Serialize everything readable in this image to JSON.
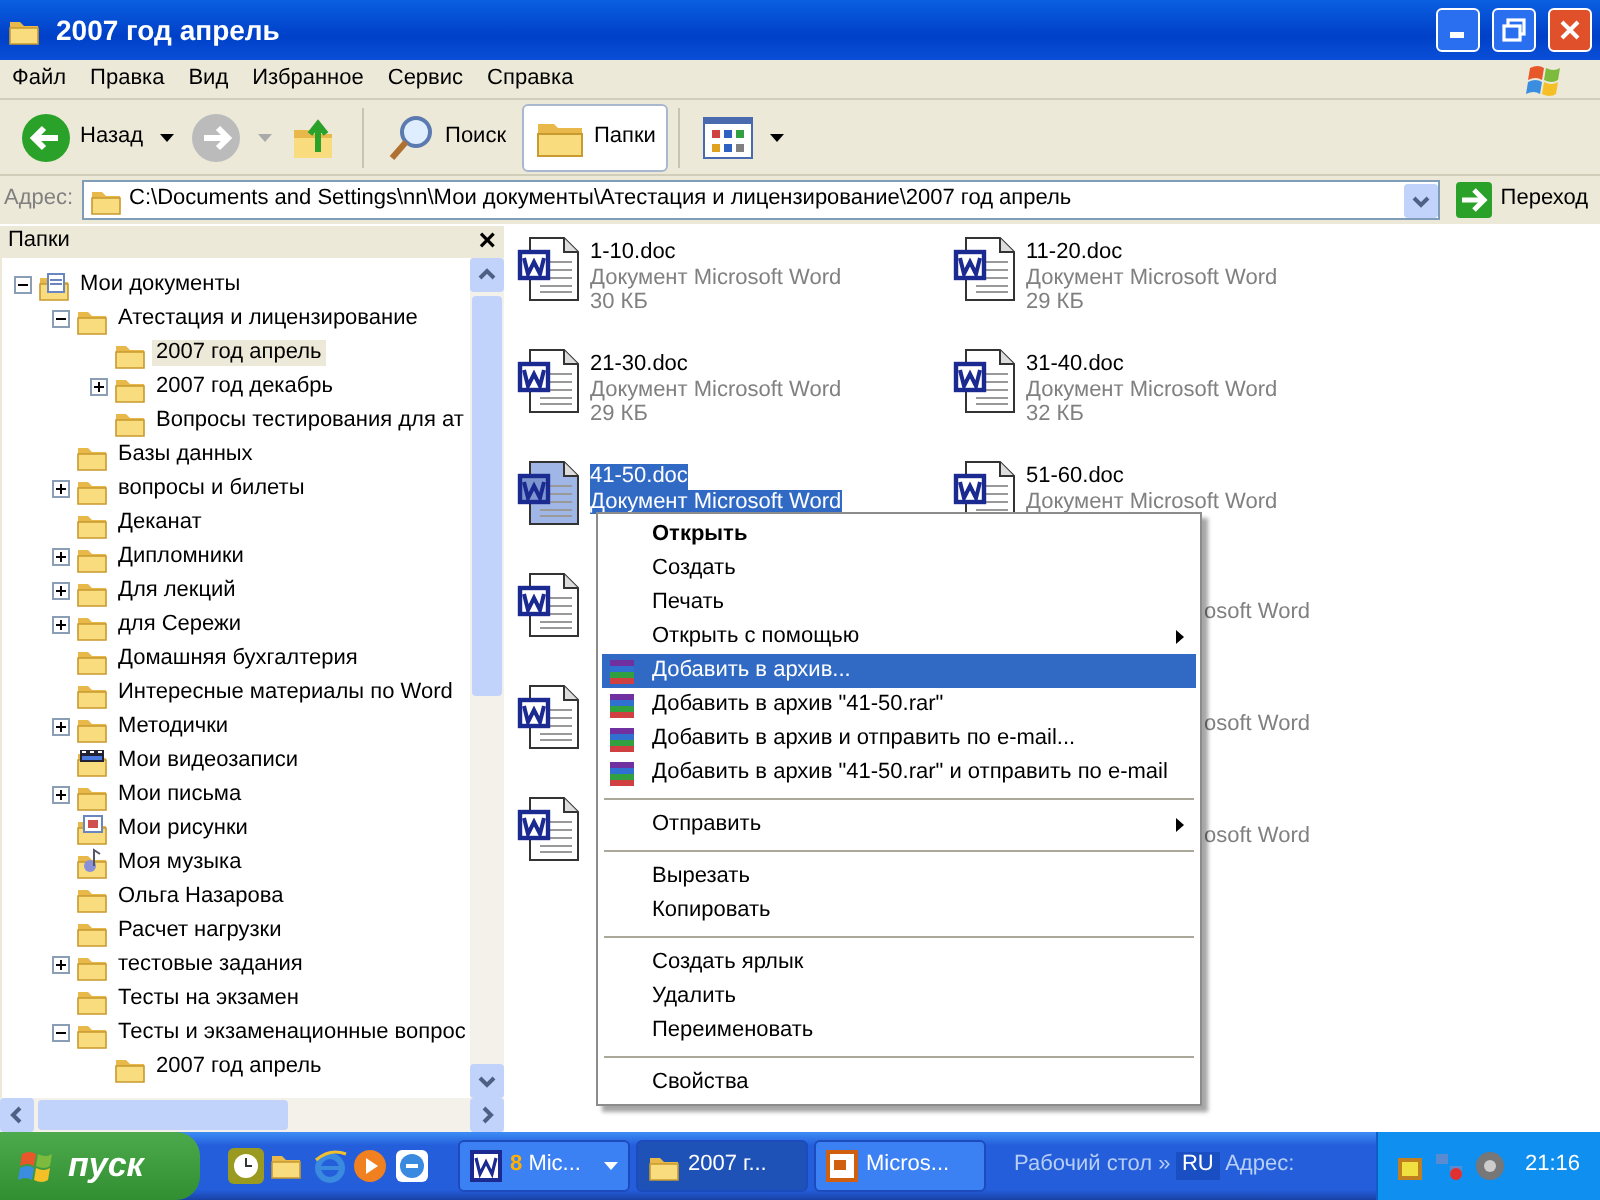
{
  "window": {
    "title": "2007 год апрель"
  },
  "menu": [
    "Файл",
    "Правка",
    "Вид",
    "Избранное",
    "Сервис",
    "Справка"
  ],
  "toolbar": [
    {
      "kind": "back",
      "label": "Назад",
      "disabled": false,
      "selected": false,
      "caret": true
    },
    {
      "kind": "forward",
      "disabled": true,
      "selected": false,
      "caret": true
    },
    {
      "kind": "up",
      "disabled": false,
      "selected": false,
      "caret": false
    },
    {
      "kind": "search",
      "label": "Поиск",
      "disabled": false,
      "selected": false,
      "caret": false
    },
    {
      "kind": "folders",
      "label": "Папки",
      "disabled": false,
      "selected": true,
      "caret": false
    },
    {
      "kind": "views",
      "disabled": false,
      "selected": false,
      "caret": true
    }
  ],
  "address": {
    "label": "Адрес:",
    "value": "C:\\Documents and Settings\\nn\\Мои документы\\Атестация и лицензирование\\2007 год апрель",
    "go": "Переход"
  },
  "folders_pane": {
    "title": "Папки",
    "close": "×"
  },
  "tree": [
    {
      "label": "Мои документы",
      "kind": "mydocs",
      "expandable": true,
      "expanded": true,
      "selected": false,
      "children": [
        {
          "label": "Атестация и лицензирование",
          "kind": "folder",
          "expandable": true,
          "expanded": true,
          "selected": false,
          "children": [
            {
              "label": "2007 год апрель",
              "kind": "folder",
              "expandable": false,
              "expanded": false,
              "selected": true
            },
            {
              "label": "2007 год декабрь",
              "kind": "folder",
              "expandable": true,
              "expanded": false,
              "selected": false
            },
            {
              "label": "Вопросы тестирования для ат",
              "kind": "folder",
              "expandable": false,
              "expanded": false,
              "selected": false
            }
          ]
        },
        {
          "label": "Базы данных",
          "kind": "folder",
          "expandable": false,
          "expanded": false,
          "selected": false
        },
        {
          "label": "вопросы и билеты",
          "kind": "folder",
          "expandable": true,
          "expanded": false,
          "selected": false
        },
        {
          "label": "Деканат",
          "kind": "folder",
          "expandable": false,
          "expanded": false,
          "selected": false
        },
        {
          "label": "Дипломники",
          "kind": "folder",
          "expandable": true,
          "expanded": false,
          "selected": false
        },
        {
          "label": "Для лекций",
          "kind": "folder",
          "expandable": true,
          "expanded": false,
          "selected": false
        },
        {
          "label": "для Сережи",
          "kind": "folder",
          "expandable": true,
          "expanded": false,
          "selected": false
        },
        {
          "label": "Домашняя бухгалтерия",
          "kind": "folder",
          "expandable": false,
          "expanded": false,
          "selected": false
        },
        {
          "label": "Интересные материалы по Word",
          "kind": "folder",
          "expandable": false,
          "expanded": false,
          "selected": false
        },
        {
          "label": "Методички",
          "kind": "folder",
          "expandable": true,
          "expanded": false,
          "selected": false
        },
        {
          "label": "Мои видеозаписи",
          "kind": "video",
          "expandable": false,
          "expanded": false,
          "selected": false
        },
        {
          "label": "Мои письма",
          "kind": "folder",
          "expandable": true,
          "expanded": false,
          "selected": false
        },
        {
          "label": "Мои рисунки",
          "kind": "pictures",
          "expandable": false,
          "expanded": false,
          "selected": false
        },
        {
          "label": "Моя музыка",
          "kind": "music",
          "expandable": false,
          "expanded": false,
          "selected": false
        },
        {
          "label": "Ольга Назарова",
          "kind": "folder",
          "expandable": false,
          "expanded": false,
          "selected": false
        },
        {
          "label": "Расчет нагрузки",
          "kind": "folder",
          "expandable": false,
          "expanded": false,
          "selected": false
        },
        {
          "label": "тестовые задания",
          "kind": "folder",
          "expandable": true,
          "expanded": false,
          "selected": false
        },
        {
          "label": "Тесты  на экзамен",
          "kind": "folder",
          "expandable": false,
          "expanded": false,
          "selected": false
        },
        {
          "label": "Тесты и экзаменационные вопрос",
          "kind": "folder",
          "expandable": true,
          "expanded": true,
          "selected": false,
          "children": [
            {
              "label": "2007 год апрель",
              "kind": "folder",
              "expandable": false,
              "expanded": false,
              "selected": false
            }
          ]
        }
      ]
    }
  ],
  "files": [
    {
      "kind": "full",
      "name": "1-10.doc",
      "type": "Документ Microsoft Word",
      "size": "30 КБ",
      "selected": false
    },
    {
      "kind": "full",
      "name": "11-20.doc",
      "type": "Документ Microsoft Word",
      "size": "29 КБ",
      "selected": false
    },
    {
      "kind": "full",
      "name": "21-30.doc",
      "type": "Документ Microsoft Word",
      "size": "29 КБ",
      "selected": false
    },
    {
      "kind": "full",
      "name": "31-40.doc",
      "type": "Документ Microsoft Word",
      "size": "32 КБ",
      "selected": false
    },
    {
      "kind": "full",
      "name": "41-50.doc",
      "type": "Документ Microsoft Word",
      "selected": true
    },
    {
      "kind": "full",
      "name": "51-60.doc",
      "type": "Документ Microsoft Word",
      "selected": false
    },
    {
      "kind": "covered",
      "selected": false
    },
    {
      "kind": "covered",
      "fragment": "osoft Word"
    },
    {
      "kind": "covered",
      "selected": false
    },
    {
      "kind": "covered",
      "fragment": "osoft Word"
    },
    {
      "kind": "covered",
      "selected": false
    },
    {
      "kind": "covered",
      "fragment": "osoft Word"
    }
  ],
  "context_menu": [
    {
      "kind": "item",
      "label": "Открыть",
      "default": true,
      "submenu": false,
      "selected": false
    },
    {
      "kind": "item",
      "label": "Создать",
      "default": false,
      "submenu": false,
      "selected": false
    },
    {
      "kind": "item",
      "label": "Печать",
      "default": false,
      "submenu": false,
      "selected": false
    },
    {
      "kind": "item",
      "label": "Открыть с помощью",
      "default": false,
      "submenu": true,
      "selected": false
    },
    {
      "kind": "archive_item",
      "label": "Добавить в архив...",
      "default": false,
      "submenu": false,
      "selected": true
    },
    {
      "kind": "archive_item",
      "label": "Добавить в архив \"41-50.rar\"",
      "default": false,
      "submenu": false,
      "selected": false
    },
    {
      "kind": "archive_item",
      "label": "Добавить в архив и отправить по e-mail...",
      "default": false,
      "submenu": false,
      "selected": false
    },
    {
      "kind": "archive_item",
      "label": "Добавить в архив \"41-50.rar\" и отправить по e-mail",
      "default": false,
      "submenu": false,
      "selected": false
    },
    {
      "kind": "separator"
    },
    {
      "kind": "item",
      "label": "Отправить",
      "default": false,
      "submenu": true,
      "selected": false
    },
    {
      "kind": "separator"
    },
    {
      "kind": "item",
      "label": "Вырезать",
      "default": false,
      "submenu": false,
      "selected": false
    },
    {
      "kind": "item",
      "label": "Копировать",
      "default": false,
      "submenu": false,
      "selected": false
    },
    {
      "kind": "separator"
    },
    {
      "kind": "item",
      "label": "Создать ярлык",
      "default": false,
      "submenu": false,
      "selected": false
    },
    {
      "kind": "item",
      "label": "Удалить",
      "default": false,
      "submenu": false,
      "selected": false
    },
    {
      "kind": "item",
      "label": "Переименовать",
      "default": false,
      "submenu": false,
      "selected": false
    },
    {
      "kind": "separator"
    },
    {
      "kind": "item",
      "label": "Свойства",
      "default": false,
      "submenu": false,
      "selected": false
    }
  ],
  "taskbar": {
    "start": "пуск",
    "tasks": [
      {
        "kind": "word",
        "count": "8",
        "label": "Mic...",
        "selected": false,
        "caret": true
      },
      {
        "kind": "folder",
        "label": "2007 г...",
        "selected": true,
        "caret": false
      },
      {
        "kind": "powerpoint",
        "label": "Micros...",
        "selected": false,
        "caret": false
      }
    ],
    "desktop": "Рабочий стол",
    "chevron": "»",
    "language": "RU",
    "address": "Адрес:",
    "clock": "21:16"
  }
}
